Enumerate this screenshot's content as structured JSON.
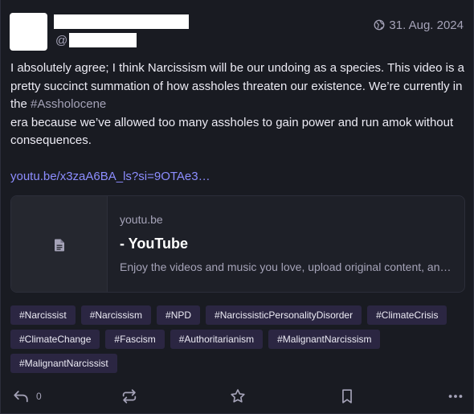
{
  "post": {
    "handle_at": "@",
    "timestamp": "31. Aug. 2024",
    "content": {
      "line1": "I absolutely agree; I think Narcissism will be our undoing as a species. This video is a pretty succinct summation of how assholes threaten our existence. We’re currently in the ",
      "hashtag_inline": "#Assholocene",
      "line2": "era because we’ve allowed too many assholes to gain power and run amok without consequences.",
      "link": "youtu.be/x3zaA6BA_ls?si=9OTAe3…"
    },
    "card": {
      "host": "youtu.be",
      "title": "- YouTube",
      "description": "Enjoy the videos and music you love, upload original content, and share it all with friends, family, and the world on YouTube."
    },
    "tags": [
      "#Narcissist",
      "#Narcissism",
      "#NPD",
      "#NarcissisticPersonalityDisorder",
      "#ClimateCrisis",
      "#ClimateChange",
      "#Fascism",
      "#Authoritarianism",
      "#MalignantNarcissism",
      "#MalignantNarcissist"
    ],
    "actions": {
      "reply_count": "0"
    }
  },
  "colors": {
    "background": "#191b22",
    "text": "#ecebf4",
    "muted": "#a5a3b8",
    "link": "#8c8dff",
    "tag_bg": "#2b2642"
  },
  "icons": [
    "globe-icon",
    "file-icon",
    "reply-icon",
    "boost-icon",
    "star-icon",
    "bookmark-icon",
    "more-icon"
  ]
}
